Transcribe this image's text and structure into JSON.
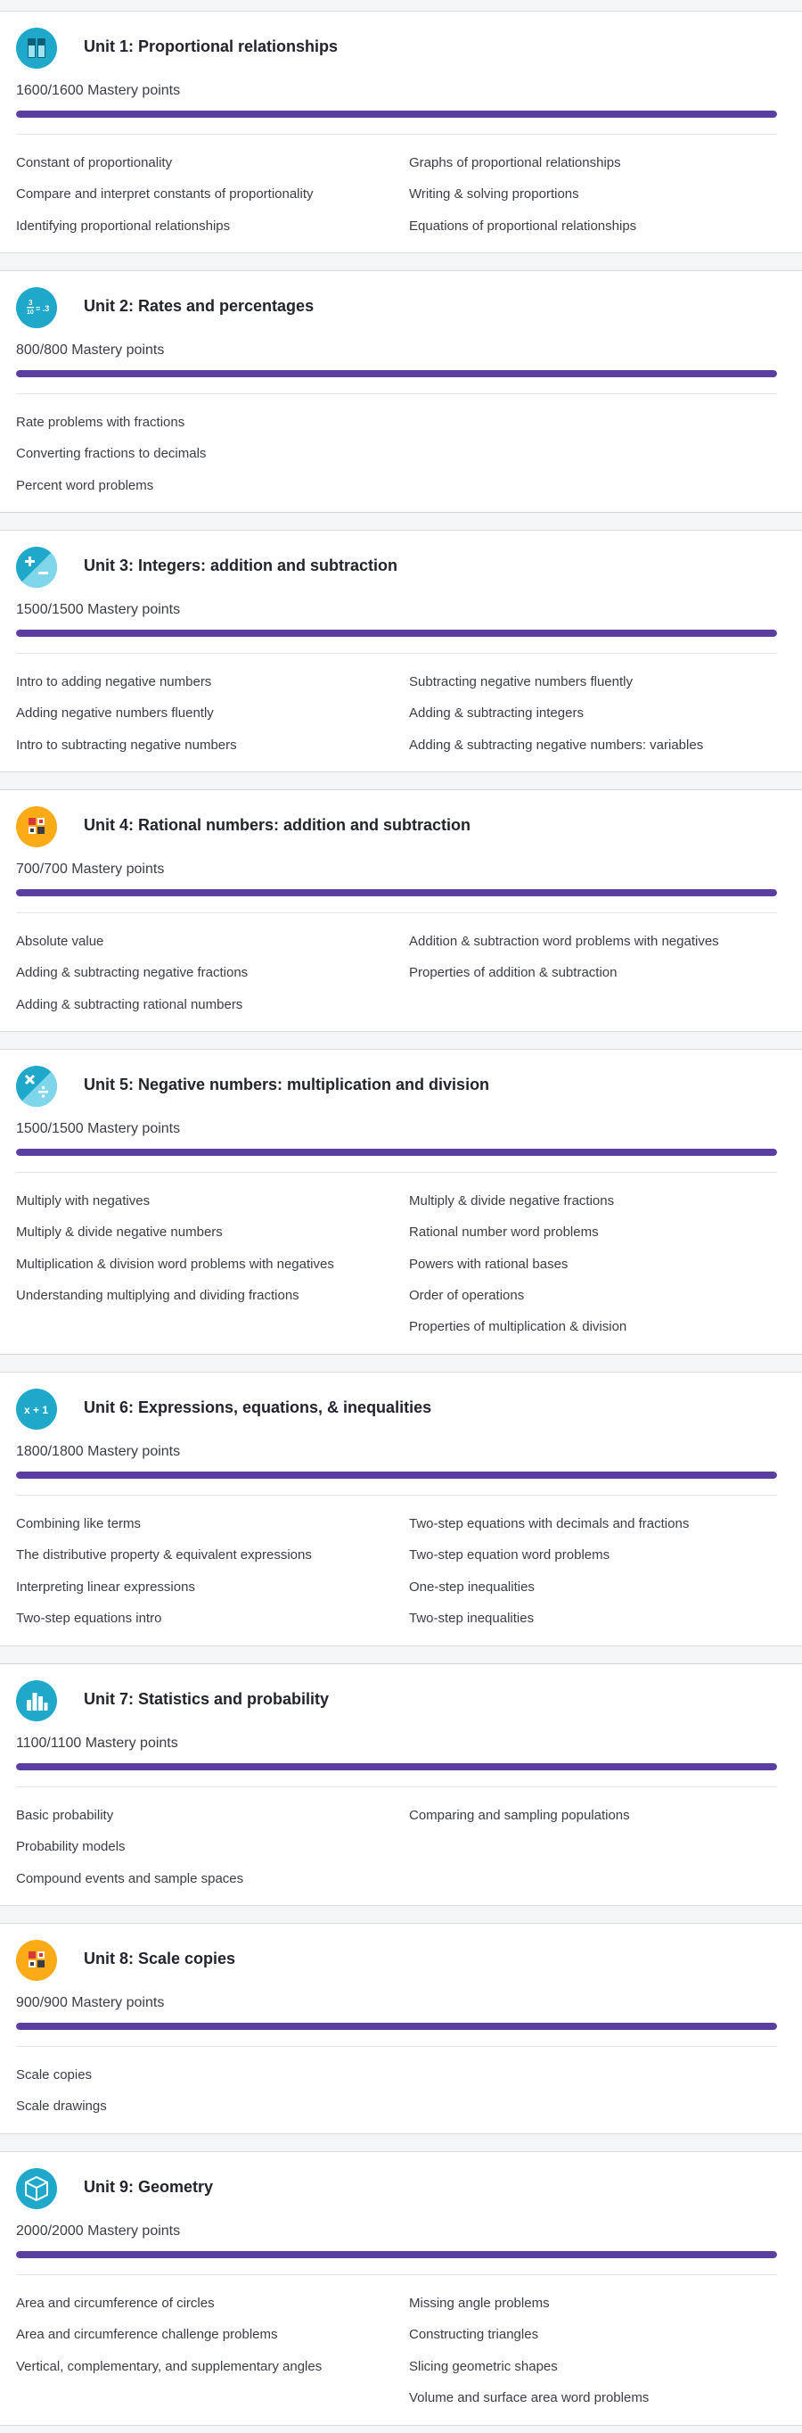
{
  "colors": {
    "progress_fill": "#5a3fa1",
    "progress_track": "#e3e5ea",
    "icon_blue": "#1fa8c9",
    "icon_orange": "#fbab16"
  },
  "units": [
    {
      "title": "Unit 1: Proportional relationships",
      "mastery": "1600/1600 Mastery points",
      "progress": 1.0,
      "icon": "proportions-icon",
      "left": [
        "Constant of proportionality",
        "Compare and interpret constants of proportionality",
        "Identifying proportional relationships"
      ],
      "right": [
        "Graphs of proportional relationships",
        "Writing & solving proportions",
        "Equations of proportional relationships"
      ]
    },
    {
      "title": "Unit 2: Rates and percentages",
      "mastery": "800/800 Mastery points",
      "progress": 1.0,
      "icon": "fraction-icon",
      "left": [
        "Rate problems with fractions",
        "Converting fractions to decimals",
        "Percent word problems"
      ],
      "right": []
    },
    {
      "title": "Unit 3: Integers: addition and subtraction",
      "mastery": "1500/1500 Mastery points",
      "progress": 1.0,
      "icon": "plus-minus-icon",
      "left": [
        "Intro to adding negative numbers",
        "Adding negative numbers fluently",
        "Intro to subtracting negative numbers"
      ],
      "right": [
        "Subtracting negative numbers fluently",
        "Adding & subtracting integers",
        "Adding & subtracting negative numbers: variables"
      ]
    },
    {
      "title": "Unit 4: Rational numbers: addition and subtraction",
      "mastery": "700/700 Mastery points",
      "progress": 1.0,
      "icon": "blocks-icon",
      "left": [
        "Absolute value",
        "Adding & subtracting negative fractions",
        "Adding & subtracting rational numbers"
      ],
      "right": [
        "Addition & subtraction word problems with negatives",
        "Properties of addition & subtraction"
      ]
    },
    {
      "title": "Unit 5: Negative numbers: multiplication and division",
      "mastery": "1500/1500 Mastery points",
      "progress": 1.0,
      "icon": "multiply-divide-icon",
      "left": [
        "Multiply with negatives",
        "Multiply & divide negative numbers",
        "Multiplication & division word problems with negatives",
        "Understanding multiplying and dividing fractions"
      ],
      "right": [
        "Multiply & divide negative fractions",
        "Rational number word problems",
        "Powers with rational bases",
        "Order of operations",
        "Properties of multiplication & division"
      ]
    },
    {
      "title": "Unit 6: Expressions, equations, & inequalities",
      "mastery": "1800/1800 Mastery points",
      "progress": 1.0,
      "icon": "expression-icon",
      "left": [
        "Combining like terms",
        "The distributive property & equivalent expressions",
        "Interpreting linear expressions",
        "Two-step equations intro"
      ],
      "right": [
        "Two-step equations with decimals and fractions",
        "Two-step equation word problems",
        "One-step inequalities",
        "Two-step inequalities"
      ]
    },
    {
      "title": "Unit 7: Statistics and probability",
      "mastery": "1100/1100 Mastery points",
      "progress": 1.0,
      "icon": "bar-chart-icon",
      "left": [
        "Basic probability",
        "Probability models",
        "Compound events and sample spaces"
      ],
      "right": [
        "Comparing and sampling populations"
      ]
    },
    {
      "title": "Unit 8: Scale copies",
      "mastery": "900/900 Mastery points",
      "progress": 1.0,
      "icon": "blocks-icon",
      "left": [
        "Scale copies",
        "Scale drawings"
      ],
      "right": []
    },
    {
      "title": "Unit 9: Geometry",
      "mastery": "2000/2000 Mastery points",
      "progress": 1.0,
      "icon": "cube-icon",
      "left": [
        "Area and circumference of circles",
        "Area and circumference challenge problems",
        "Vertical, complementary, and supplementary angles"
      ],
      "right": [
        "Missing angle problems",
        "Constructing triangles",
        "Slicing geometric shapes",
        "Volume and surface area word problems"
      ]
    }
  ]
}
